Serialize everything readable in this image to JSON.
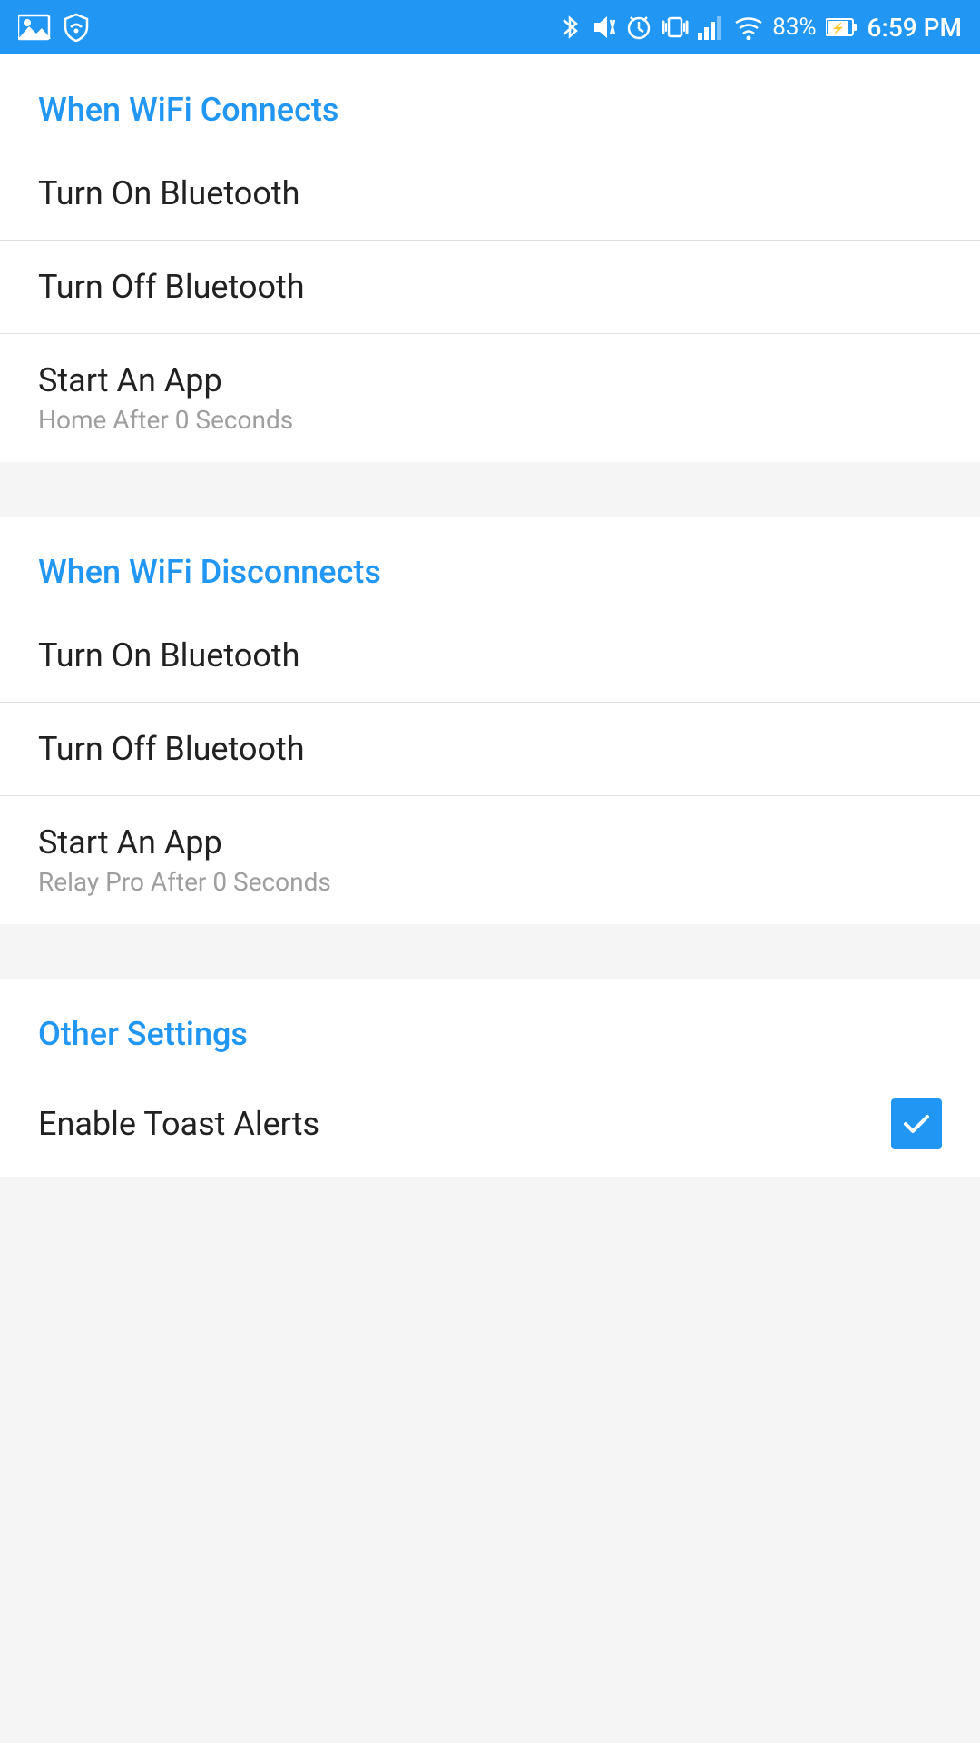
{
  "statusBar": {
    "time": "6:59 PM",
    "battery": "83%",
    "icons": {
      "bluetooth": "✦",
      "mute": "🔇",
      "alarm": "⏰",
      "vibrate": "📳",
      "signal": "▲",
      "wifi": "▲",
      "battery_icon": "⚡"
    }
  },
  "sections": [
    {
      "id": "wifi-connects",
      "header": "When WiFi Connects",
      "items": [
        {
          "id": "turn-on-bt-connect",
          "title": "Turn On Bluetooth",
          "subtitle": null,
          "hasCheckbox": false
        },
        {
          "id": "turn-off-bt-connect",
          "title": "Turn Off Bluetooth",
          "subtitle": null,
          "hasCheckbox": false
        },
        {
          "id": "start-app-connect",
          "title": "Start An App",
          "subtitle": "Home After 0 Seconds",
          "hasCheckbox": false
        }
      ]
    },
    {
      "id": "wifi-disconnects",
      "header": "When WiFi Disconnects",
      "items": [
        {
          "id": "turn-on-bt-disconnect",
          "title": "Turn On Bluetooth",
          "subtitle": null,
          "hasCheckbox": false
        },
        {
          "id": "turn-off-bt-disconnect",
          "title": "Turn Off Bluetooth",
          "subtitle": null,
          "hasCheckbox": false
        },
        {
          "id": "start-app-disconnect",
          "title": "Start An App",
          "subtitle": "Relay Pro After 0 Seconds",
          "hasCheckbox": false
        }
      ]
    },
    {
      "id": "other-settings",
      "header": "Other Settings",
      "items": [
        {
          "id": "enable-toast-alerts",
          "title": "Enable Toast Alerts",
          "subtitle": null,
          "hasCheckbox": true,
          "checkboxChecked": true
        }
      ]
    }
  ]
}
